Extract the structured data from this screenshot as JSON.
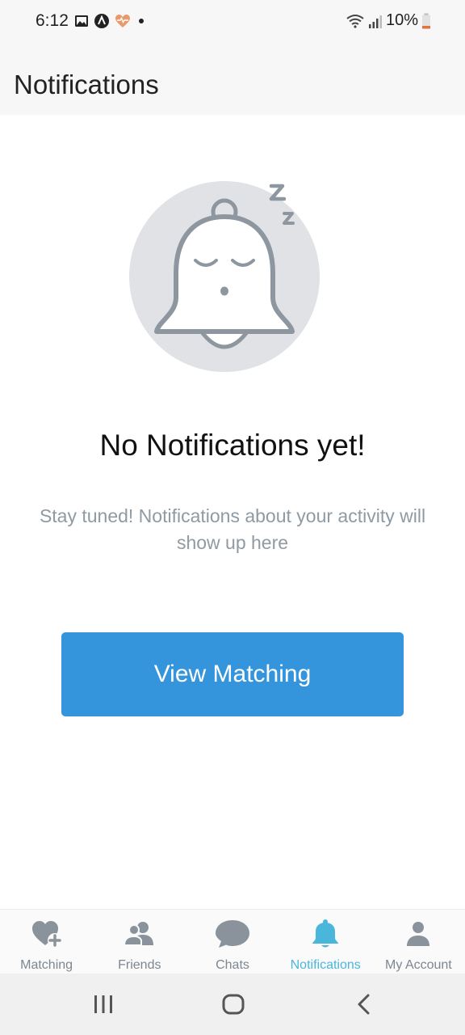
{
  "status_bar": {
    "time": "6:12",
    "battery": "10%"
  },
  "header": {
    "title": "Notifications"
  },
  "empty_state": {
    "title": "No Notifications yet!",
    "subtitle": "Stay tuned! Notifications about your activity will show up here",
    "illustration": "sleeping-bell-icon"
  },
  "cta": {
    "label": "View Matching"
  },
  "tabs": [
    {
      "label": "Matching",
      "icon": "heart-plus-icon",
      "active": false
    },
    {
      "label": "Friends",
      "icon": "people-icon",
      "active": false
    },
    {
      "label": "Chats",
      "icon": "chat-bubble-icon",
      "active": false
    },
    {
      "label": "Notifications",
      "icon": "bell-icon",
      "active": true
    },
    {
      "label": "My Account",
      "icon": "person-icon",
      "active": false
    }
  ],
  "colors": {
    "accent": "#3595dc",
    "active_tab": "#4ab6dc",
    "inactive_tab": "#7d878f"
  }
}
